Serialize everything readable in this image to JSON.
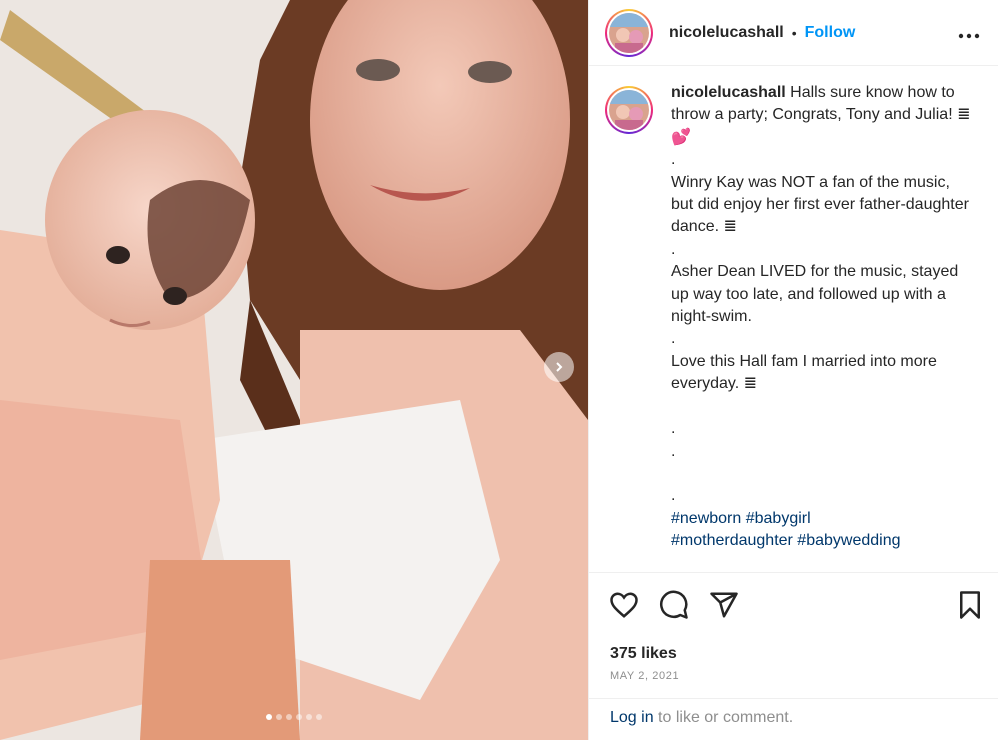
{
  "post": {
    "username": "nicolelucashall",
    "separator": "•",
    "follow_label": "Follow",
    "more_icon": "more-horizontal-icon",
    "caption_user": "nicolelucashall",
    "caption_body": " Halls sure know how to throw a party; Congrats, Tony and Julia! ≣💕\n.\nWinry Kay was NOT a fan of the music, but did enjoy her first ever father-daughter dance. ≣\n.\nAsher Dean LIVED for the music, stayed up way too late, and followed up with a night-swim.\n.\nLove this Hall fam I married into more everyday. ≣\n\n.\n.\n\n.\n",
    "hashtags_line1": "#newborn #babygirl",
    "hashtags_line2": "#motherdaughter #babywedding",
    "likes": "375 likes",
    "date": "MAY 2, 2021",
    "login_link": "Log in",
    "login_rest": " to like or comment.",
    "carousel": {
      "count": 6,
      "active": 0
    }
  },
  "icons": [
    "heart-icon",
    "comment-icon",
    "share-icon",
    "bookmark-icon",
    "chevron-right-icon"
  ],
  "colors": {
    "accent": "#0095f6",
    "link": "#00376b",
    "muted": "#8e8e8e",
    "border": "#efefef"
  }
}
